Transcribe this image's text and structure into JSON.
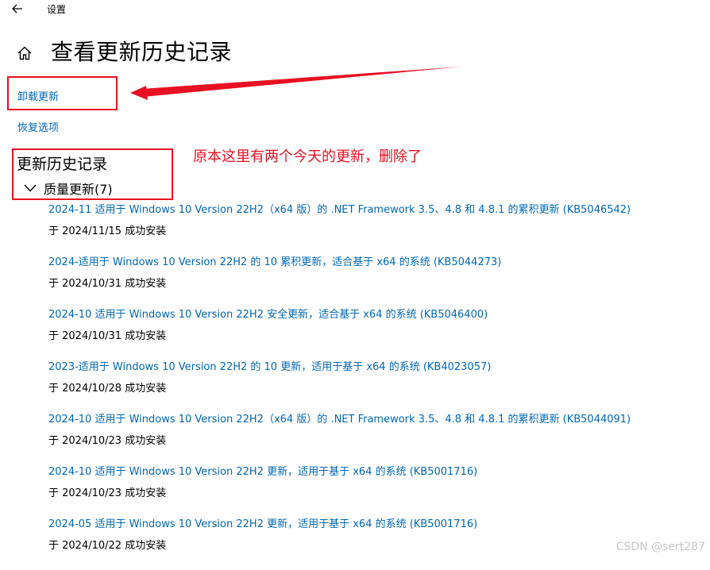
{
  "window": {
    "title": "设置",
    "back_icon": "arrow-left-icon"
  },
  "header": {
    "home_icon": "home-icon",
    "page_title": "查看更新历史记录"
  },
  "links": {
    "uninstall": "卸载更新",
    "recovery": "恢复选项"
  },
  "history": {
    "heading": "更新历史记录",
    "category": {
      "label": "质量更新(7)",
      "expanded": true,
      "icon": "chevron-down-icon"
    },
    "updates": [
      {
        "title": "2024-11 适用于 Windows 10 Version 22H2（x64 版）的 .NET Framework 3.5、4.8 和 4.8.1 的累积更新 (KB5046542)",
        "status": "于 2024/11/15 成功安装"
      },
      {
        "title": "2024-适用于 Windows 10 Version 22H2 的 10 累积更新，适合基于 x64 的系统 (KB5044273)",
        "status": "于 2024/10/31 成功安装"
      },
      {
        "title": "2024-10 适用于 Windows 10 Version 22H2 安全更新，适合基于 x64 的系统 (KB5046400)",
        "status": "于 2024/10/31 成功安装"
      },
      {
        "title": "2023-适用于 Windows 10 Version 22H2 的 10 更新，适用于基于 x64 的系统 (KB4023057)",
        "status": "于 2024/10/28 成功安装"
      },
      {
        "title": "2024-10 适用于 Windows 10 Version 22H2（x64 版）的 .NET Framework 3.5、4.8 和 4.8.1 的累积更新 (KB5044091)",
        "status": "于 2024/10/23 成功安装"
      },
      {
        "title": "2024-10 适用于 Windows 10 Version 22H2 更新，适用于基于 x64 的系统 (KB5001716)",
        "status": "于 2024/10/23 成功安装"
      },
      {
        "title": "2024-05 适用于 Windows 10 Version 22H2 更新，适用于基于 x64 的系统 (KB5001716)",
        "status": "于 2024/10/22 成功安装"
      }
    ]
  },
  "annotation": {
    "note": "原本这里有两个今天的更新，删除了",
    "color": "#e81123"
  },
  "watermark": "CSDN @sert287",
  "colors": {
    "link": "#0067b8",
    "background": "#ffffff",
    "text": "#000000"
  }
}
